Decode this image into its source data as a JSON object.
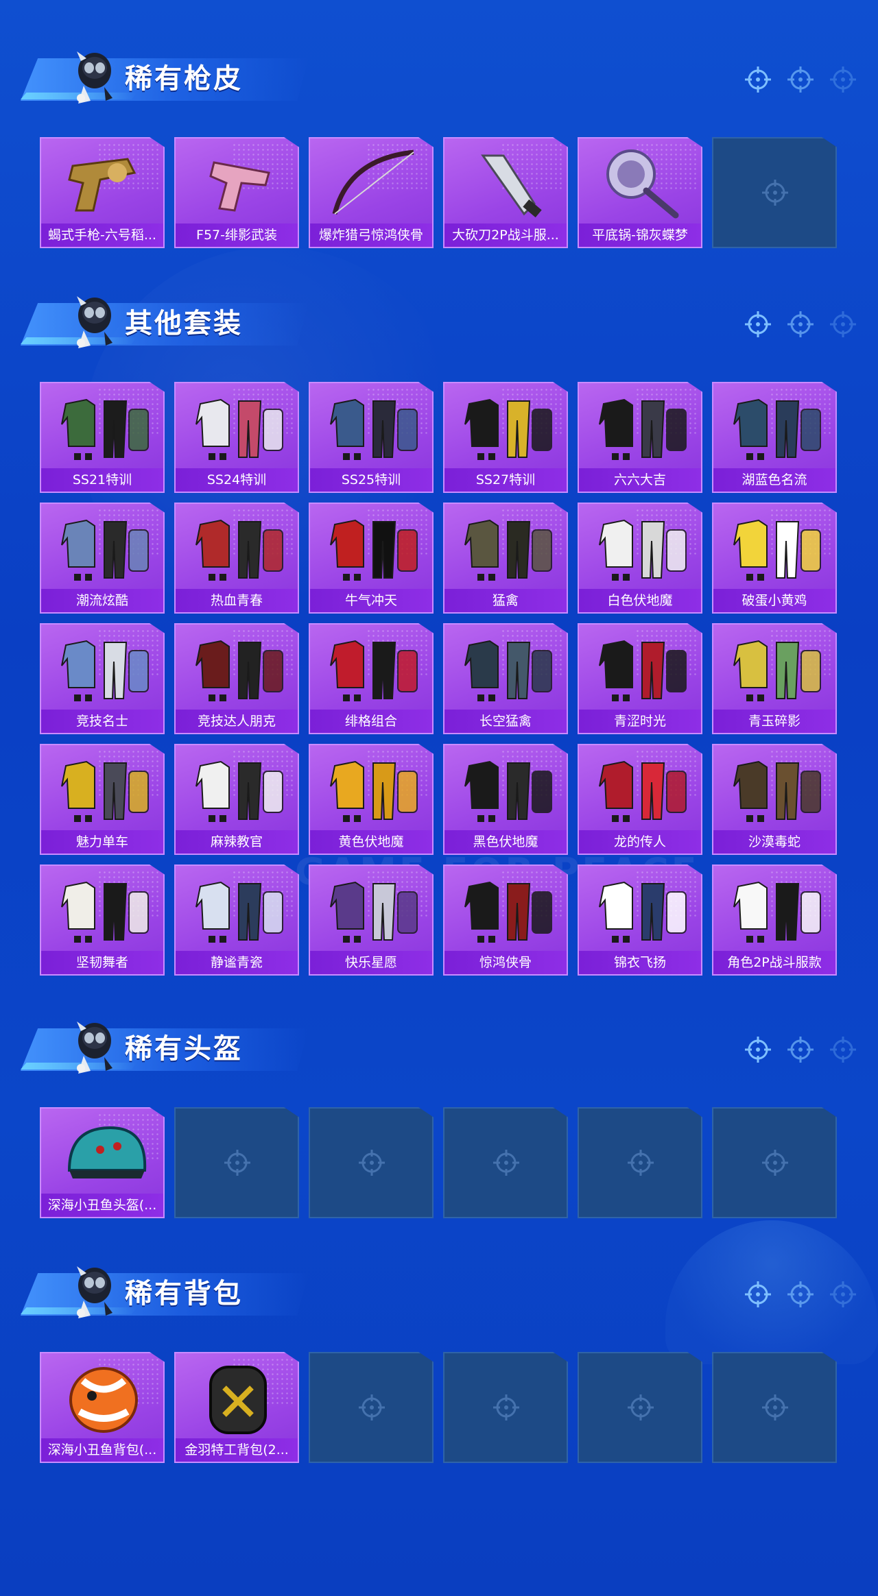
{
  "sections": [
    {
      "title": "稀有枪皮",
      "items": [
        "蝎式手枪-六号稻...",
        "F57-绯影武装",
        "爆炸猎弓惊鸿侠骨",
        "大砍刀2P战斗服...",
        "平底锅-锦灰蝶梦"
      ]
    },
    {
      "title": "其他套装",
      "items": [
        "SS21特训",
        "SS24特训",
        "SS25特训",
        "SS27特训",
        "六六大吉",
        "湖蓝色名流",
        "潮流炫酷",
        "热血青春",
        "牛气冲天",
        "猛禽",
        "白色伏地魔",
        "破蛋小黄鸡",
        "竞技名士",
        "竞技达人朋克",
        "绯格组合",
        "长空猛禽",
        "青涩时光",
        "青玉碎影",
        "魅力单车",
        "麻辣教官",
        "黄色伏地魔",
        "黑色伏地魔",
        "龙的传人",
        "沙漠毒蛇",
        "坚韧舞者",
        "静谧青瓷",
        "快乐星愿",
        "惊鸿侠骨",
        "锦衣飞扬",
        "角色2P战斗服款"
      ]
    },
    {
      "title": "稀有头盔",
      "items": [
        "深海小丑鱼头盔(..."
      ]
    },
    {
      "title": "稀有背包",
      "items": [
        "深海小丑鱼背包(...",
        "金羽特工背包(2..."
      ]
    }
  ],
  "background_text": "GAME FOR PEACE",
  "colors": {
    "background": "#0b46c9",
    "card_filled": "#9a44e6",
    "card_label": "#7b20d8",
    "card_empty": "#1d4a86"
  }
}
